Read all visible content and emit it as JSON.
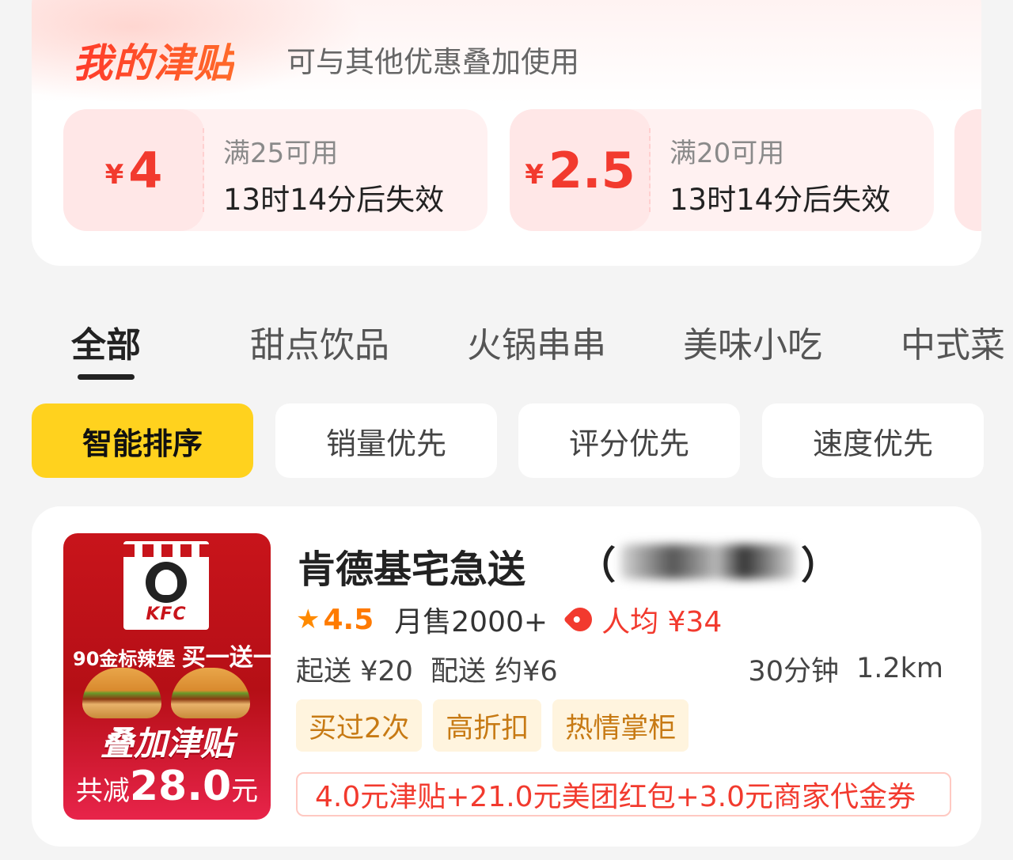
{
  "subsidy": {
    "title": "我的津贴",
    "subtitle": "可与其他优惠叠加使用",
    "coupons": [
      {
        "currency": "¥",
        "amount": "4",
        "condition": "满25可用",
        "expiry": "13时14分后失效"
      },
      {
        "currency": "¥",
        "amount": "2.5",
        "condition": "满20可用",
        "expiry": "13时14分后失效"
      }
    ]
  },
  "tabs": [
    {
      "label": "全部",
      "active": true
    },
    {
      "label": "甜点饮品"
    },
    {
      "label": "火锅串串"
    },
    {
      "label": "美味小吃"
    },
    {
      "label": "中式菜"
    }
  ],
  "sort": [
    {
      "label": "智能排序",
      "active": true
    },
    {
      "label": "销量优先"
    },
    {
      "label": "评分优先"
    },
    {
      "label": "速度优先"
    }
  ],
  "store": {
    "name": "肯德基宅急送",
    "name_paren_open": "（",
    "name_paren_close": "）",
    "thumb": {
      "brand": "KFC",
      "promo_small": "90金标辣堡",
      "promo_big": "买一送一",
      "stack": "叠加津贴",
      "total_label": "共减",
      "total_value": "28.0",
      "total_unit": "元"
    },
    "rating": "4.5",
    "monthly_sales": "月售2000+",
    "avg_price": "人均 ¥34",
    "min_order": "起送 ¥20",
    "delivery_fee": "配送 约¥6",
    "eta": "30分钟",
    "distance": "1.2km",
    "tags": [
      "买过2次",
      "高折扣",
      "热情掌柜"
    ],
    "promo": "4.0元津贴+21.0元美团红包+3.0元商家代金券"
  },
  "colors": {
    "accent_red": "#f23a2e",
    "sort_active": "#ffd21e",
    "rating_orange": "#ff7a00",
    "tag_text": "#c77a14"
  }
}
